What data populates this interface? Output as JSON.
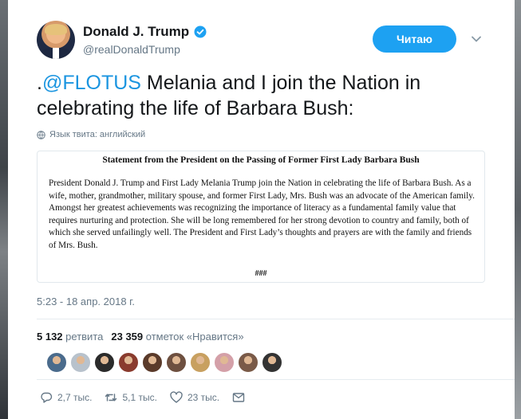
{
  "header": {
    "display_name": "Donald J. Trump",
    "handle": "@realDonaldTrump",
    "follow_label": "Читаю"
  },
  "tweet": {
    "prefix": ".",
    "mention": "@FLOTUS",
    "text": " Melania and I join the Nation in celebrating the life of Barbara Bush:",
    "language_note": "Язык твита: английский",
    "timestamp": "5:23 - 18 апр. 2018 г."
  },
  "statement": {
    "title": "Statement from the President on the Passing of Former First Lady Barbara Bush",
    "body": "President Donald J. Trump and First Lady Melania Trump join the Nation in celebrating the life of Barbara Bush. As a wife, mother, grandmother, military spouse, and former First Lady, Mrs. Bush was an advocate of the American family. Amongst her greatest achievements was recognizing the importance of literacy as a fundamental family value that requires nurturing and protection. She will be long remembered for her strong devotion to country and family, both of which she served unfailingly well. The President and First Lady’s thoughts and prayers are with the family and friends of Mrs. Bush.",
    "end_mark": "###"
  },
  "stats": {
    "retweets_count": "5 132",
    "retweets_label": "ретвита",
    "likes_count": "23 359",
    "likes_label": "отметок «Нравится»"
  },
  "likers": [
    {
      "name": "liker-1",
      "color": "#4a6b8c"
    },
    {
      "name": "liker-2",
      "color": "#b8c2cc"
    },
    {
      "name": "liker-3",
      "color": "#2b2b2b"
    },
    {
      "name": "liker-4",
      "color": "#8a3b2e"
    },
    {
      "name": "liker-5",
      "color": "#5a3a2a"
    },
    {
      "name": "liker-6",
      "color": "#6e5040"
    },
    {
      "name": "liker-7",
      "color": "#c8a060"
    },
    {
      "name": "liker-8",
      "color": "#d4a0a8"
    },
    {
      "name": "liker-9",
      "color": "#7a5a48"
    },
    {
      "name": "liker-10",
      "color": "#333333"
    }
  ],
  "actions": {
    "replies": "2,7 тыс.",
    "retweets": "5,1 тыс.",
    "likes": "23 тыс."
  },
  "colors": {
    "accent": "#1da1f2",
    "mention": "#1b95e0",
    "muted": "#657786"
  }
}
